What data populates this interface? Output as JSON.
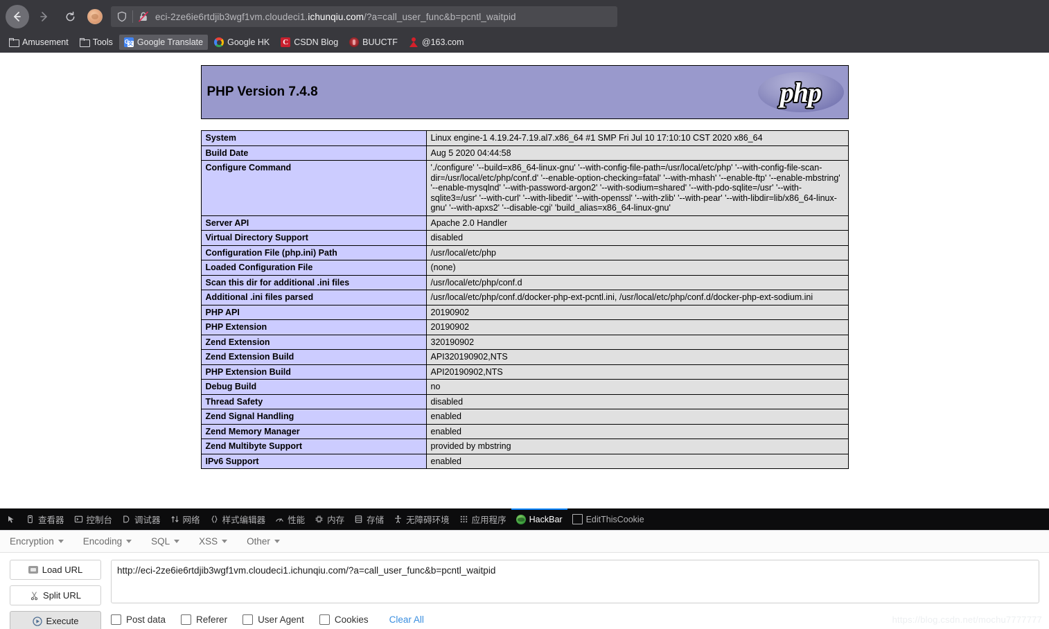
{
  "browser": {
    "nav": {
      "back": "back-arrow",
      "forward": "forward-arrow",
      "reload": "reload",
      "profile": "profile-avatar"
    },
    "url": {
      "prefix": "eci-2ze6ie6rtdjib3wgf1vm.cloudeci1.",
      "host": "ichunqiu.com",
      "suffix": "/?a=call_user_func&b=pcntl_waitpid",
      "full": "eci-2ze6ie6rtdjib3wgf1vm.cloudeci1.ichunqiu.com/?a=call_user_func&b=pcntl_waitpid"
    },
    "bookmarks": [
      {
        "label": "Amusement",
        "icon": "folder-icon",
        "active": false
      },
      {
        "label": "Tools",
        "icon": "folder-icon",
        "active": false
      },
      {
        "label": "Google Translate",
        "icon": "google-translate-icon",
        "active": true
      },
      {
        "label": "Google HK",
        "icon": "google-icon",
        "active": false
      },
      {
        "label": "CSDN Blog",
        "icon": "csdn-icon",
        "active": false
      },
      {
        "label": "BUUCTF",
        "icon": "buuctf-icon",
        "active": false
      },
      {
        "label": "@163.com",
        "icon": "mail163-icon",
        "active": false
      }
    ]
  },
  "phpinfo": {
    "version_title": "PHP Version 7.4.8",
    "logo_text": "php",
    "rows": [
      {
        "key": "System",
        "value": "Linux engine-1 4.19.24-7.19.al7.x86_64 #1 SMP Fri Jul 10 17:10:10 CST 2020 x86_64"
      },
      {
        "key": "Build Date",
        "value": "Aug 5 2020 04:44:58"
      },
      {
        "key": "Configure Command",
        "value": "'./configure' '--build=x86_64-linux-gnu' '--with-config-file-path=/usr/local/etc/php' '--with-config-file-scan-dir=/usr/local/etc/php/conf.d' '--enable-option-checking=fatal' '--with-mhash' '--enable-ftp' '--enable-mbstring' '--enable-mysqlnd' '--with-password-argon2' '--with-sodium=shared' '--with-pdo-sqlite=/usr' '--with-sqlite3=/usr' '--with-curl' '--with-libedit' '--with-openssl' '--with-zlib' '--with-pear' '--with-libdir=lib/x86_64-linux-gnu' '--with-apxs2' '--disable-cgi' 'build_alias=x86_64-linux-gnu'"
      },
      {
        "key": "Server API",
        "value": "Apache 2.0 Handler"
      },
      {
        "key": "Virtual Directory Support",
        "value": "disabled"
      },
      {
        "key": "Configuration File (php.ini) Path",
        "value": "/usr/local/etc/php"
      },
      {
        "key": "Loaded Configuration File",
        "value": "(none)"
      },
      {
        "key": "Scan this dir for additional .ini files",
        "value": "/usr/local/etc/php/conf.d"
      },
      {
        "key": "Additional .ini files parsed",
        "value": "/usr/local/etc/php/conf.d/docker-php-ext-pcntl.ini, /usr/local/etc/php/conf.d/docker-php-ext-sodium.ini"
      },
      {
        "key": "PHP API",
        "value": "20190902"
      },
      {
        "key": "PHP Extension",
        "value": "20190902"
      },
      {
        "key": "Zend Extension",
        "value": "320190902"
      },
      {
        "key": "Zend Extension Build",
        "value": "API320190902,NTS"
      },
      {
        "key": "PHP Extension Build",
        "value": "API20190902,NTS"
      },
      {
        "key": "Debug Build",
        "value": "no"
      },
      {
        "key": "Thread Safety",
        "value": "disabled"
      },
      {
        "key": "Zend Signal Handling",
        "value": "enabled"
      },
      {
        "key": "Zend Memory Manager",
        "value": "enabled"
      },
      {
        "key": "Zend Multibyte Support",
        "value": "provided by mbstring"
      },
      {
        "key": "IPv6 Support",
        "value": "enabled"
      }
    ]
  },
  "devtools": {
    "tabs": [
      {
        "label": "查看器",
        "icon": "inspector-icon",
        "active": false
      },
      {
        "label": "控制台",
        "icon": "console-icon",
        "active": false
      },
      {
        "label": "调试器",
        "icon": "debugger-icon",
        "active": false
      },
      {
        "label": "网络",
        "icon": "network-icon",
        "active": false
      },
      {
        "label": "样式编辑器",
        "icon": "style-editor-icon",
        "active": false
      },
      {
        "label": "性能",
        "icon": "performance-icon",
        "active": false
      },
      {
        "label": "内存",
        "icon": "memory-icon",
        "active": false
      },
      {
        "label": "存储",
        "icon": "storage-icon",
        "active": false
      },
      {
        "label": "无障碍环境",
        "icon": "accessibility-icon",
        "active": false
      },
      {
        "label": "应用程序",
        "icon": "application-icon",
        "active": false
      },
      {
        "label": "HackBar",
        "icon": "hackbar-icon",
        "active": true
      },
      {
        "label": "EditThisCookie",
        "icon": "editthiscookie-icon",
        "active": false
      }
    ],
    "accent_color": "#0a84ff"
  },
  "hackbar": {
    "menu": [
      {
        "label": "Encryption"
      },
      {
        "label": "Encoding"
      },
      {
        "label": "SQL"
      },
      {
        "label": "XSS"
      },
      {
        "label": "Other"
      }
    ],
    "buttons": [
      {
        "label": "Load URL",
        "icon": "load-url-icon",
        "pressed": false
      },
      {
        "label": "Split URL",
        "icon": "scissors-icon",
        "pressed": false
      },
      {
        "label": "Execute",
        "icon": "play-icon",
        "pressed": true
      }
    ],
    "url_value": "http://eci-2ze6ie6rtdjib3wgf1vm.cloudeci1.ichunqiu.com/?a=call_user_func&b=pcntl_waitpid",
    "url_placeholder": "http://",
    "options": [
      {
        "label": "Post data",
        "checked": false
      },
      {
        "label": "Referer",
        "checked": false
      },
      {
        "label": "User Agent",
        "checked": false
      },
      {
        "label": "Cookies",
        "checked": false
      }
    ],
    "clear_all": "Clear All"
  },
  "watermark": "https://blog.csdn.net/mochu7777777"
}
